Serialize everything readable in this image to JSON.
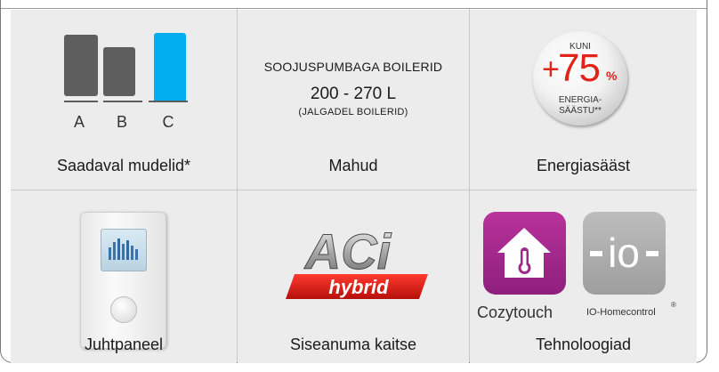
{
  "cells": {
    "models": {
      "letters": [
        "A",
        "B",
        "C"
      ],
      "caption": "Saadaval mudelid*",
      "colors": {
        "inactive": "#5e5e5e",
        "active": "#00aeef"
      }
    },
    "volume": {
      "heading": "SOOJUSPUMBAGA BOILERID",
      "range": "200 - 270 L",
      "note": "(JALGADEL BOILERID)",
      "caption": "Mahud"
    },
    "energy": {
      "badge_top": "KUNI",
      "badge_plus": "+",
      "badge_value": "75",
      "badge_unit": "%",
      "badge_line1": "ENERGIA-",
      "badge_line2": "SÄÄSTU**",
      "caption": "Energiasääst",
      "accent": "#e2231a"
    },
    "panel": {
      "caption": "Juhtpaneel"
    },
    "protection": {
      "logo_main": "ACi",
      "logo_sub": "hybrid",
      "caption": "Siseanuma kaitse"
    },
    "tech": {
      "cozytouch_label": "Cozytouch",
      "io_label": "IO-Homecontrol",
      "io_mark": "®",
      "io_logo": "io",
      "caption": "Tehnoloogiad",
      "cozytouch_color": "#9c2a8a"
    }
  }
}
